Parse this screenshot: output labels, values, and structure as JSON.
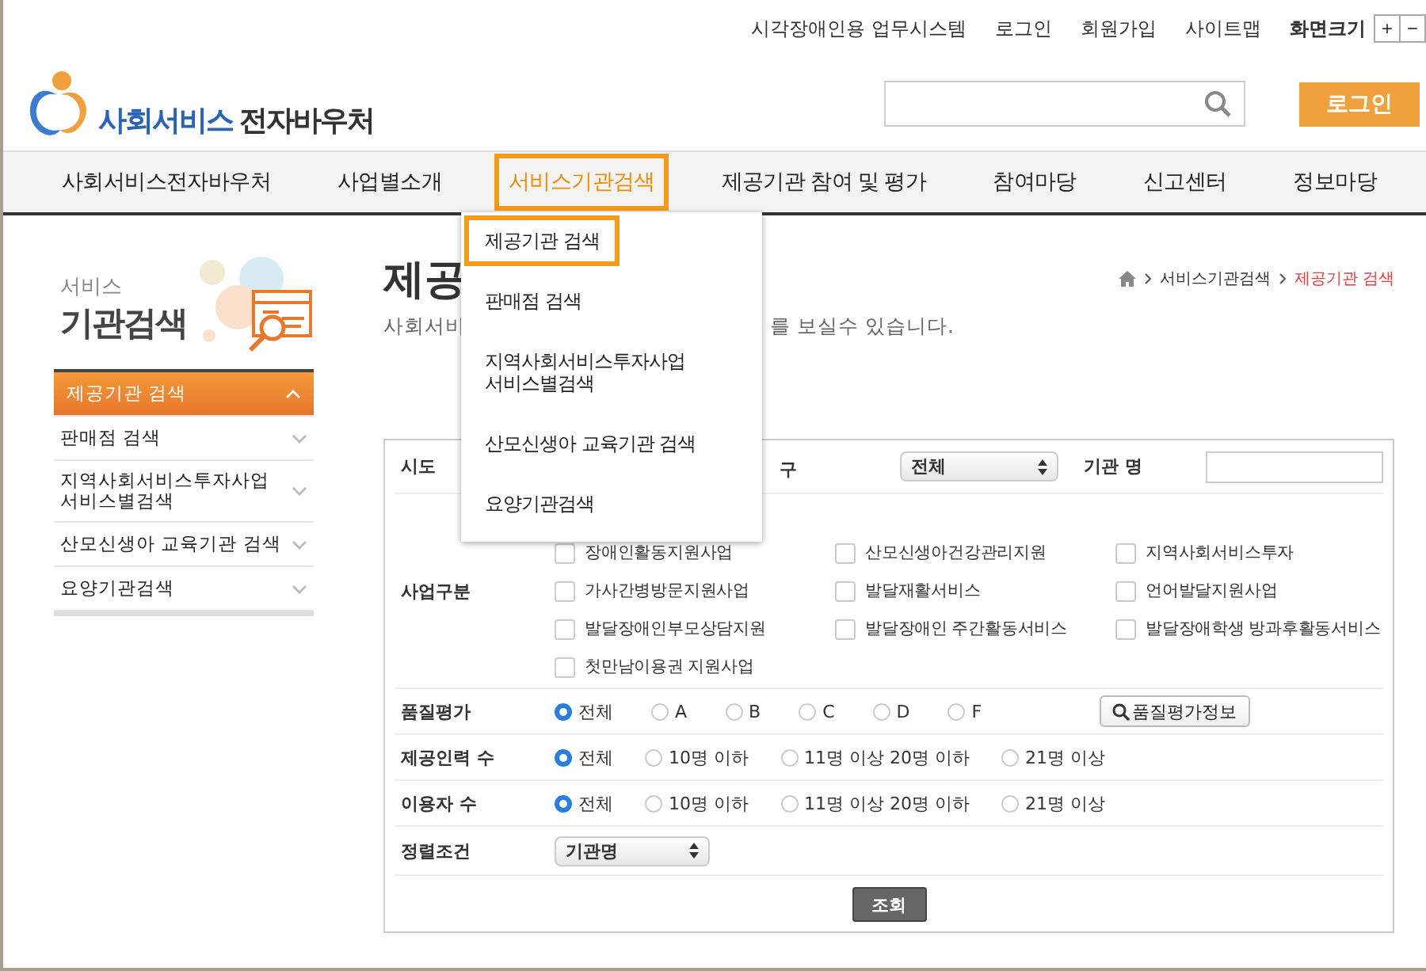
{
  "top_links": [
    {
      "label": "시각장애인용 업무시스템"
    },
    {
      "label": "로그인"
    },
    {
      "label": "회원가입"
    },
    {
      "label": "사이트맵"
    }
  ],
  "font_size": {
    "label": "화면크기",
    "buttons": [
      "+",
      "−"
    ]
  },
  "logo": {
    "brand": "사회서비스",
    "suffix": "전자바우처"
  },
  "login_button": "로그인",
  "nav": [
    {
      "label": "사회서비스전자바우처",
      "selected": false
    },
    {
      "label": "사업별소개",
      "selected": false
    },
    {
      "label": "서비스기관검색",
      "selected": true
    },
    {
      "label": "제공기관 참여 및 평가",
      "selected": false
    },
    {
      "label": "참여마당",
      "selected": false
    },
    {
      "label": "신고센터",
      "selected": false
    },
    {
      "label": "정보마당",
      "selected": false
    }
  ],
  "dropdown": {
    "items": [
      {
        "label": "제공기관 검색",
        "selected": true
      },
      {
        "label": "판매점 검색",
        "selected": false
      },
      {
        "label": "지역사회서비스투자사업\n서비스별검색",
        "selected": false
      },
      {
        "label": "산모신생아 교육기관 검색",
        "selected": false
      },
      {
        "label": "요양기관검색",
        "selected": false
      }
    ]
  },
  "sidebar": {
    "banner": {
      "small": "서비스",
      "large": "기관검색"
    },
    "items": [
      {
        "label": "제공기관 검색",
        "selected": true
      },
      {
        "label": "판매점 검색",
        "selected": false
      },
      {
        "label": "지역사회서비스투자사업\n서비스별검색",
        "selected": false
      },
      {
        "label": "산모신생아 교육기관 검색",
        "selected": false
      },
      {
        "label": "요양기관검색",
        "selected": false
      }
    ]
  },
  "page": {
    "title": "제공",
    "breadcrumb": [
      {
        "label": "서비스기관검색",
        "current": false
      },
      {
        "label": "제공기관 검색",
        "current": true
      }
    ],
    "description_left": "사회서비",
    "description_right": "를 보실수 있습니다."
  },
  "form": {
    "region_row": {
      "label": "시도",
      "district_label": "구",
      "district_select": "전체",
      "name_label": "기관 명"
    },
    "business": {
      "label": "사업구분",
      "options": [
        {
          "label": "장애인활동지원사업",
          "checked": false
        },
        {
          "label": "산모신생아건강관리지원",
          "checked": false
        },
        {
          "label": "지역사회서비스투자",
          "checked": false
        },
        {
          "label": "가사간병방문지원사업",
          "checked": false
        },
        {
          "label": "발달재활서비스",
          "checked": false
        },
        {
          "label": "언어발달지원사업",
          "checked": false
        },
        {
          "label": "발달장애인부모상담지원",
          "checked": false
        },
        {
          "label": "발달장애인 주간활동서비스",
          "checked": false
        },
        {
          "label": "발달장애학생 방과후활동서비스",
          "checked": false
        },
        {
          "label": "첫만남이용권 지원사업",
          "checked": false
        }
      ]
    },
    "radio_groups": [
      {
        "label": "품질평가",
        "options": [
          {
            "label": "전체",
            "selected": true
          },
          {
            "label": "A",
            "selected": false
          },
          {
            "label": "B",
            "selected": false
          },
          {
            "label": "C",
            "selected": false
          },
          {
            "label": "D",
            "selected": false
          },
          {
            "label": "F",
            "selected": false
          }
        ],
        "info_button": "품질평가정보"
      },
      {
        "label": "제공인력 수",
        "options": [
          {
            "label": "전체",
            "selected": true
          },
          {
            "label": "10명 이하",
            "selected": false
          },
          {
            "label": "11명 이상 20명 이하",
            "selected": false
          },
          {
            "label": "21명 이상",
            "selected": false
          }
        ]
      },
      {
        "label": "이용자 수",
        "options": [
          {
            "label": "전체",
            "selected": true
          },
          {
            "label": "10명 이하",
            "selected": false
          },
          {
            "label": "11명 이상 20명 이하",
            "selected": false
          },
          {
            "label": "21명 이상",
            "selected": false
          }
        ]
      }
    ],
    "sort": {
      "label": "정렬조건",
      "value": "기관명"
    },
    "submit": "조회"
  }
}
